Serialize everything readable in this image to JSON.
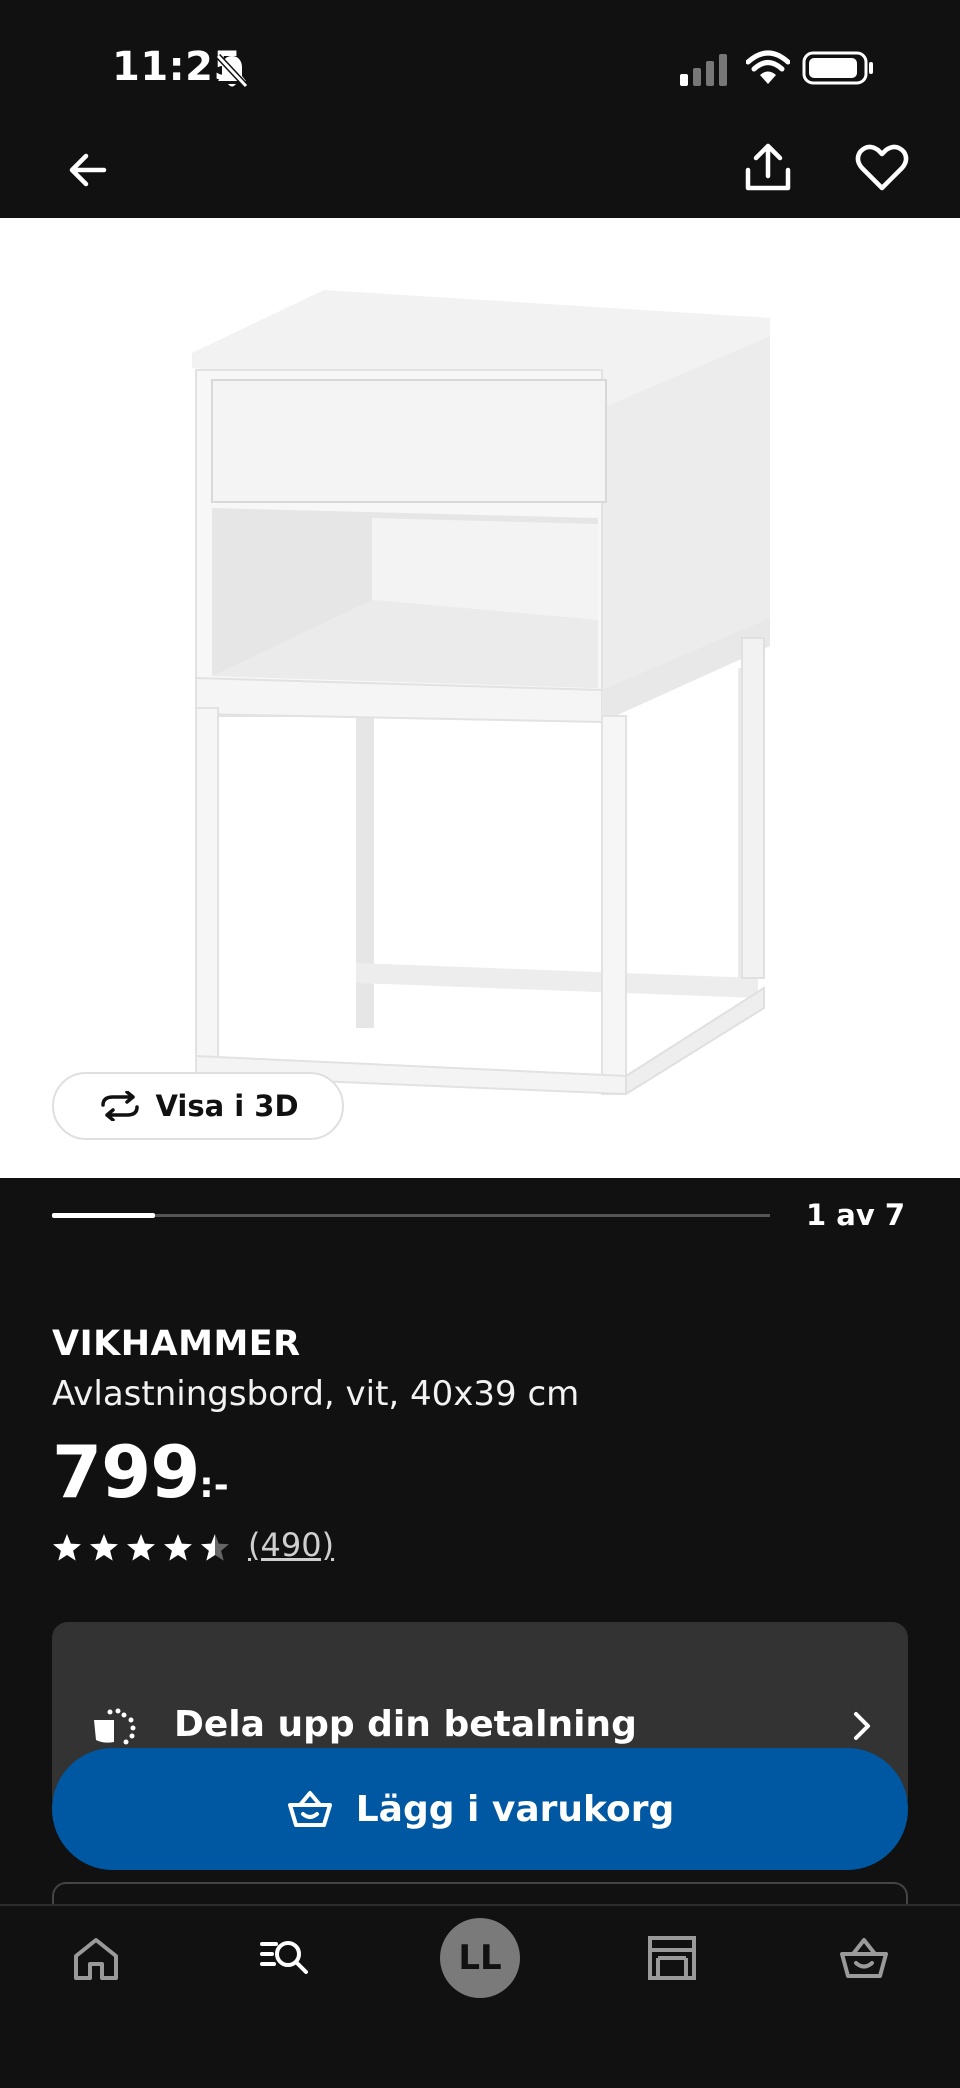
{
  "status_bar": {
    "time": "11:25"
  },
  "top_bar": {
    "back": "back-arrow-icon",
    "share": "share-icon",
    "favorite": "heart-icon"
  },
  "gallery": {
    "view_3d_label": "Visa i 3D",
    "page_indicator": "1 av 7",
    "current_page": 1,
    "total_pages": 7
  },
  "product": {
    "name": "VIKHAMMER",
    "description": "Avlastningsbord, vit, 40x39 cm",
    "price": "799",
    "price_suffix": ":-",
    "rating": 4.5,
    "rating_max": 5,
    "review_count": "(490)"
  },
  "payment": {
    "label": "Dela upp din betalning"
  },
  "cart": {
    "label": "Lägg i varukorg"
  },
  "bottom_nav": {
    "avatar_initials": "LL",
    "items": [
      "home-icon",
      "search-icon",
      "avatar",
      "store-icon",
      "cart-icon"
    ]
  },
  "colors": {
    "background": "#111111",
    "primary_button": "#0058a3",
    "card": "#333333"
  }
}
